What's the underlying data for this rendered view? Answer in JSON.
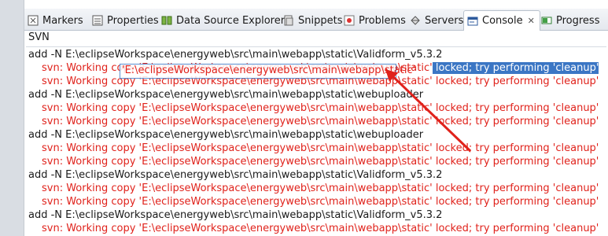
{
  "tabs": [
    {
      "label": "Markers",
      "icon": "markers-icon"
    },
    {
      "label": "Properties",
      "icon": "properties-icon"
    },
    {
      "label": "Data Source Explorer",
      "icon": "data-source-icon"
    },
    {
      "label": "Snippets",
      "icon": "snippets-icon"
    },
    {
      "label": "Problems",
      "icon": "problems-icon"
    },
    {
      "label": "Servers",
      "icon": "servers-icon"
    },
    {
      "label": "Console",
      "icon": "console-icon",
      "active": true
    },
    {
      "label": "Progress",
      "icon": "progress-icon"
    }
  ],
  "console": {
    "title": "SVN",
    "lines": [
      {
        "type": "add",
        "text": "add -N E:\\eclipseWorkspace\\energyweb\\src\\main\\webapp\\static\\Validform_v5.3.2"
      },
      {
        "type": "err",
        "pre": "svn: Working copy 'E:\\eclipseWorkspace\\energyweb\\src\\main\\webapp\\static'",
        "sel": " locked; try performing 'cleanup'"
      },
      {
        "type": "err",
        "text": "svn: Working copy 'E:\\eclipseWorkspace\\energyweb\\src\\main\\webapp\\static' locked; try performing 'cleanup'"
      },
      {
        "type": "add",
        "text": "add -N E:\\eclipseWorkspace\\energyweb\\src\\main\\webapp\\static\\webuploader"
      },
      {
        "type": "err",
        "text": "svn: Working copy 'E:\\eclipseWorkspace\\energyweb\\src\\main\\webapp\\static' locked; try performing 'cleanup'"
      },
      {
        "type": "err",
        "text": "svn: Working copy 'E:\\eclipseWorkspace\\energyweb\\src\\main\\webapp\\static' locked; try performing 'cleanup'"
      },
      {
        "type": "add",
        "text": "add -N E:\\eclipseWorkspace\\energyweb\\src\\main\\webapp\\static\\webuploader"
      },
      {
        "type": "err",
        "text": "svn: Working copy 'E:\\eclipseWorkspace\\energyweb\\src\\main\\webapp\\static' locked; try performing 'cleanup'"
      },
      {
        "type": "err",
        "text": "svn: Working copy 'E:\\eclipseWorkspace\\energyweb\\src\\main\\webapp\\static' locked; try performing 'cleanup'"
      },
      {
        "type": "add",
        "text": "add -N E:\\eclipseWorkspace\\energyweb\\src\\main\\webapp\\static\\Validform_v5.3.2"
      },
      {
        "type": "err",
        "text": "svn: Working copy 'E:\\eclipseWorkspace\\energyweb\\src\\main\\webapp\\static' locked; try performing 'cleanup'"
      },
      {
        "type": "err",
        "text": "svn: Working copy 'E:\\eclipseWorkspace\\energyweb\\src\\main\\webapp\\static' locked; try performing 'cleanup'"
      },
      {
        "type": "add",
        "text": "add -N E:\\eclipseWorkspace\\energyweb\\src\\main\\webapp\\static\\Validform_v5.3.2"
      },
      {
        "type": "err",
        "text": "svn: Working copy 'E:\\eclipseWorkspace\\energyweb\\src\\main\\webapp\\static' locked; try performing 'cleanup'"
      }
    ]
  },
  "hover_text": "'E:\\eclipseWorkspace\\energyweb\\src\\main\\webapp\\static'",
  "colors": {
    "error_text": "#e0221b",
    "selection": "#3b76c4",
    "annotation_arrow": "#e0221b"
  }
}
